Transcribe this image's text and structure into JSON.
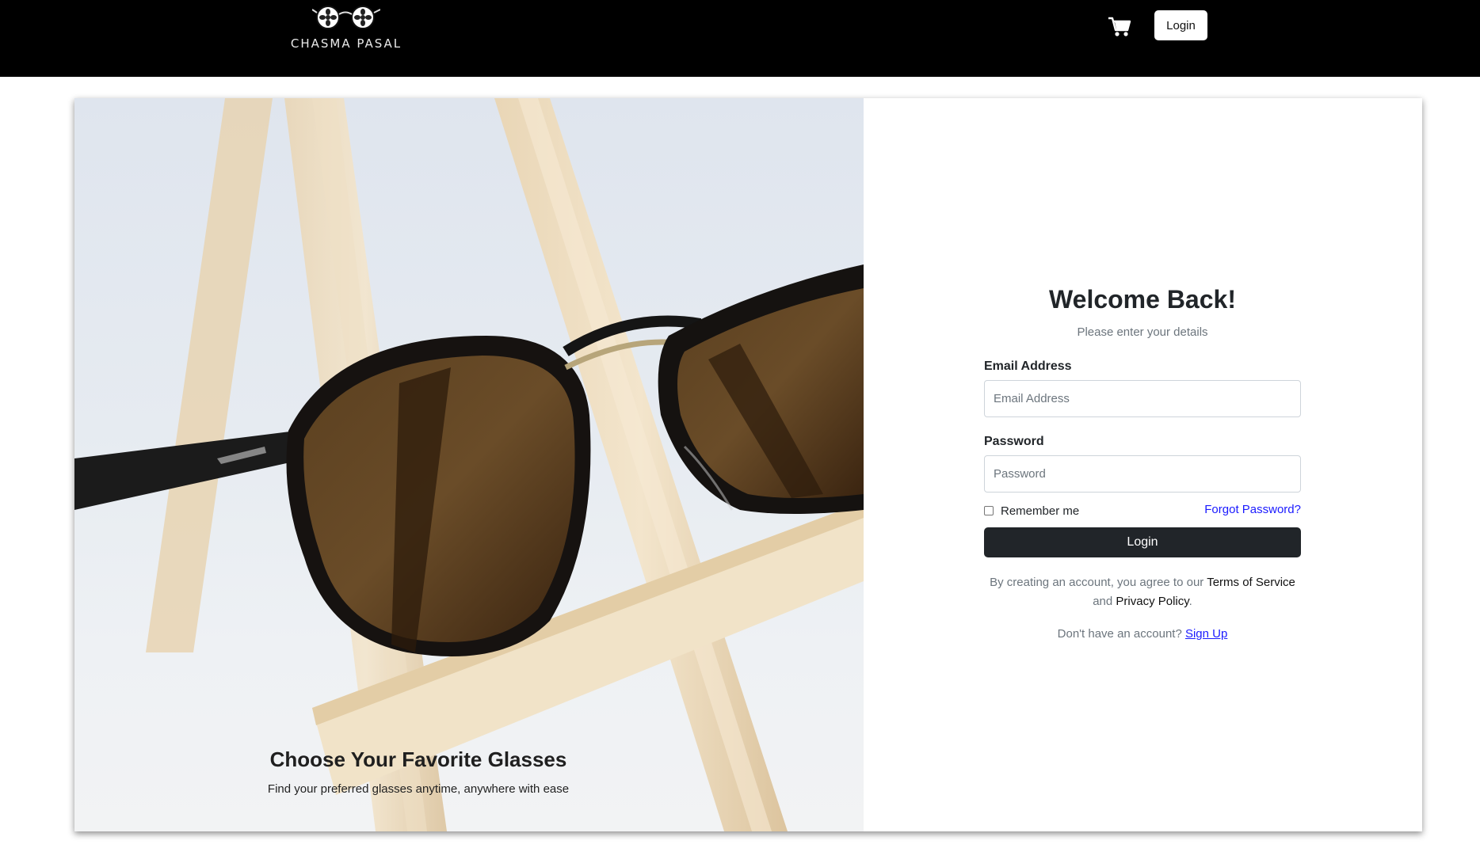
{
  "header": {
    "logo_text": "CHASMA PASAL",
    "cart_icon": "shopping-cart-icon",
    "login_label": "Login"
  },
  "hero": {
    "title": "Choose Your Favorite Glasses",
    "subtitle": "Find your preferred glasses anytime, anywhere with ease"
  },
  "login_form": {
    "title": "Welcome Back!",
    "subtitle": "Please enter your details",
    "email_label": "Email Address",
    "email_placeholder": "Email Address",
    "email_value": "",
    "password_label": "Password",
    "password_placeholder": "Password",
    "password_value": "",
    "remember_label": "Remember me",
    "remember_checked": false,
    "forgot_label": "Forgot Password?",
    "submit_label": "Login",
    "terms_prefix": "By creating an account, you agree to our ",
    "terms_link": "Terms of Service",
    "terms_and": " and ",
    "privacy_link": "Privacy Policy",
    "terms_suffix": ".",
    "signup_prompt": "Don't have an account? ",
    "signup_link": "Sign Up"
  },
  "colors": {
    "navbar": "#000000",
    "primary_button": "#212529",
    "link": "#1a1aff"
  }
}
